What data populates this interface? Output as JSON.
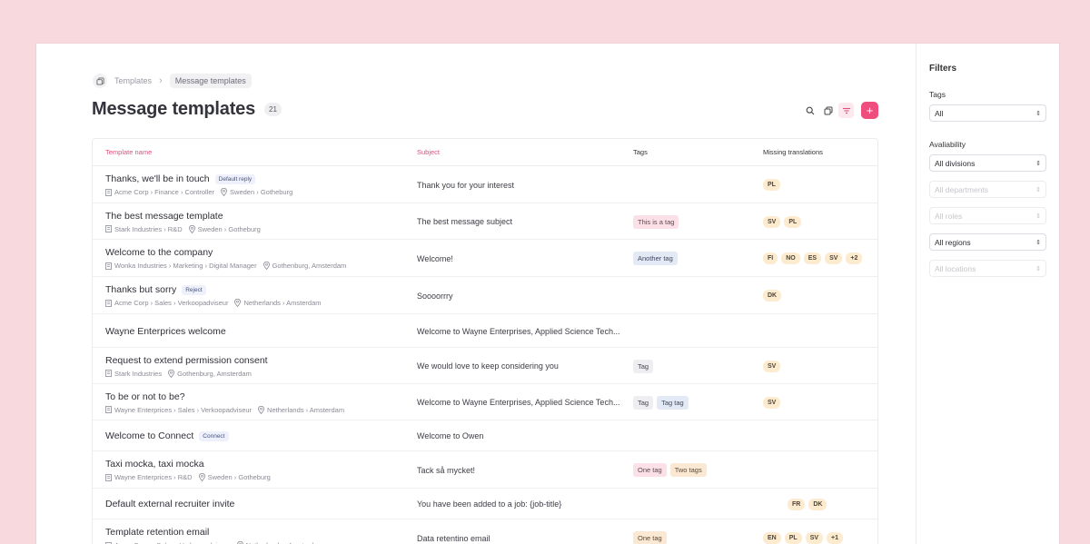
{
  "breadcrumb": {
    "root": "Templates",
    "current": "Message templates"
  },
  "page": {
    "title": "Message templates",
    "count": "21"
  },
  "toolbar": {
    "add_label": "+"
  },
  "table": {
    "headers": {
      "name": "Template name",
      "subject": "Subject",
      "tags": "Tags",
      "missing": "Missing translations"
    },
    "rows": [
      {
        "name": "Thanks, we'll be in touch",
        "badge": "Default reply",
        "company": "Acme Corp › Finance › Controller",
        "location": "Sweden › Gotheburg",
        "subject": "Thank you for your interest",
        "tags": [],
        "langs": [
          "PL"
        ]
      },
      {
        "name": "The best message template",
        "badge": "",
        "company": "Stark Industries › R&D",
        "location": "Sweden › Gotheburg",
        "subject": "The best message subject",
        "tags": [
          {
            "label": "This is a tag",
            "style": "pink"
          }
        ],
        "langs": [
          "SV",
          "PL"
        ]
      },
      {
        "name": "Welcome to the company",
        "badge": "",
        "company": "Wonka Industries › Marketing › Digital Manager",
        "location": "Gothenburg, Amsterdam",
        "subject": "Welcome!",
        "tags": [
          {
            "label": "Another tag",
            "style": "blue"
          }
        ],
        "langs": [
          "FI",
          "NO",
          "ES",
          "SV",
          "+2"
        ]
      },
      {
        "name": "Thanks but sorry",
        "badge": "Reject",
        "company": "Acme Corp › Sales › Verkoopadviseur",
        "location": "Netherlands › Amsterdam",
        "subject": "Soooorrry",
        "tags": [],
        "langs": [
          "DK"
        ]
      },
      {
        "name": "Wayne Enterprices welcome",
        "badge": "",
        "company": "",
        "location": "",
        "subject": "Welcome to Wayne Enterprises, Applied Science Tech...",
        "tags": [],
        "langs": []
      },
      {
        "name": "Request to extend permission consent",
        "badge": "",
        "company": "Stark Industries",
        "location": "Gothenburg, Amsterdam",
        "subject": "We would love to keep considering you",
        "tags": [
          {
            "label": "Tag",
            "style": "gray"
          }
        ],
        "langs": [
          "SV"
        ]
      },
      {
        "name": "To be or not to be?",
        "badge": "",
        "company": "Wayne Enterprices › Sales › Verkoopadviseur",
        "location": "Netherlands › Amsterdam",
        "subject": "Welcome to Wayne Enterprises, Applied Science Tech...",
        "tags": [
          {
            "label": "Tag",
            "style": "gray"
          },
          {
            "label": "Tag tag",
            "style": "blue"
          }
        ],
        "langs": [
          "SV"
        ]
      },
      {
        "name": "Welcome to Connect",
        "badge": "Connect",
        "company": "",
        "location": "",
        "subject": "Welcome to Owen",
        "tags": [],
        "langs": []
      },
      {
        "name": "Taxi mocka, taxi mocka",
        "badge": "",
        "company": "Wayne Enterprices › R&D",
        "location": "Sweden › Gotheburg",
        "subject": "Tack så mycket!",
        "tags": [
          {
            "label": "One tag",
            "style": "pink"
          },
          {
            "label": "Two tags",
            "style": "peach"
          }
        ],
        "langs": []
      },
      {
        "name": "Default external recruiter invite",
        "badge": "",
        "company": "",
        "location": "",
        "subject": "You have been added to a job: {job-title}",
        "tags": [],
        "langs": [
          "FR",
          "DK"
        ]
      },
      {
        "name": "Template retention email",
        "badge": "",
        "company": "Acme Corp. › Sales › Verkoopadviseur",
        "location": "Netherlands › Amsterdam",
        "subject": "Data retentino email",
        "tags": [
          {
            "label": "One tag",
            "style": "peach"
          }
        ],
        "langs": [
          "EN",
          "PL",
          "SV",
          "+1"
        ]
      }
    ]
  },
  "filters": {
    "title": "Filters",
    "tags_label": "Tags",
    "tags_value": "All",
    "availability_label": "Avaliability",
    "divisions": "All divisions",
    "departments": "All departments",
    "roles": "All roles",
    "regions": "All regions",
    "locations": "All locations"
  },
  "colors": {
    "accent": "#ee4d7e",
    "header_pink": "#e0507a",
    "background": "#f7d9de"
  },
  "icons": {
    "home": "copy-icon",
    "search": "search-icon",
    "duplicate": "duplicate-icon",
    "filter": "filter-icon",
    "building": "building-icon",
    "pin": "location-pin-icon",
    "chevron": "chevron-updown-icon"
  }
}
